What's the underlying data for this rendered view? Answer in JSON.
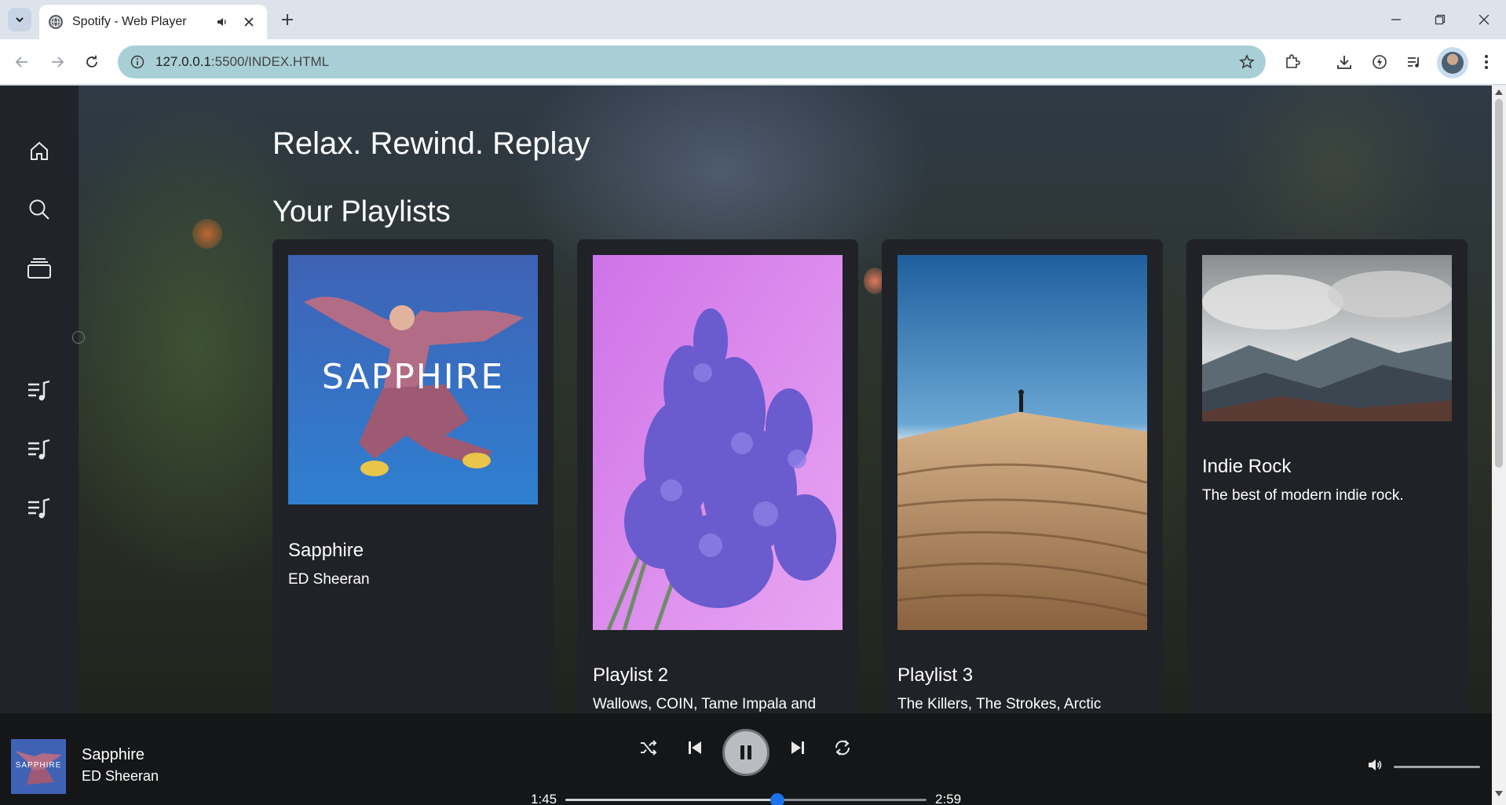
{
  "browser": {
    "tab_title": "Spotify - Web Player",
    "url_host": "127.0.0.1",
    "url_rest": ":5500/INDEX.HTML"
  },
  "page": {
    "hero_title": "Relax. Rewind. Replay",
    "section_title": "Your Playlists"
  },
  "playlists": [
    {
      "title": "Sapphire",
      "subtitle": "ED Sheeran"
    },
    {
      "title": "Playlist 2",
      "subtitle": "Wallows, COIN, Tame Impala and"
    },
    {
      "title": "Playlist 3",
      "subtitle": "The Killers, The Strokes, Arctic"
    },
    {
      "title": "Indie Rock",
      "subtitle": "The best of modern indie rock."
    }
  ],
  "player": {
    "track": "Sapphire",
    "artist": "ED Sheeran",
    "elapsed": "1:45",
    "duration": "2:59",
    "progress": 0.587,
    "volume": 1.0
  },
  "colors": {
    "sidebar": "#202329",
    "card": "#202227",
    "player_bg": "#141618",
    "progress_knob": "#1a73e8",
    "omnibox": "#a9cfd6"
  },
  "icons": {
    "sidebar": [
      "home-icon",
      "search-icon",
      "library-icon",
      "playlist-icon",
      "playlist-icon",
      "playlist-icon"
    ],
    "player": [
      "shuffle-icon",
      "previous-icon",
      "pause-icon",
      "next-icon",
      "repeat-icon",
      "volume-icon"
    ]
  }
}
